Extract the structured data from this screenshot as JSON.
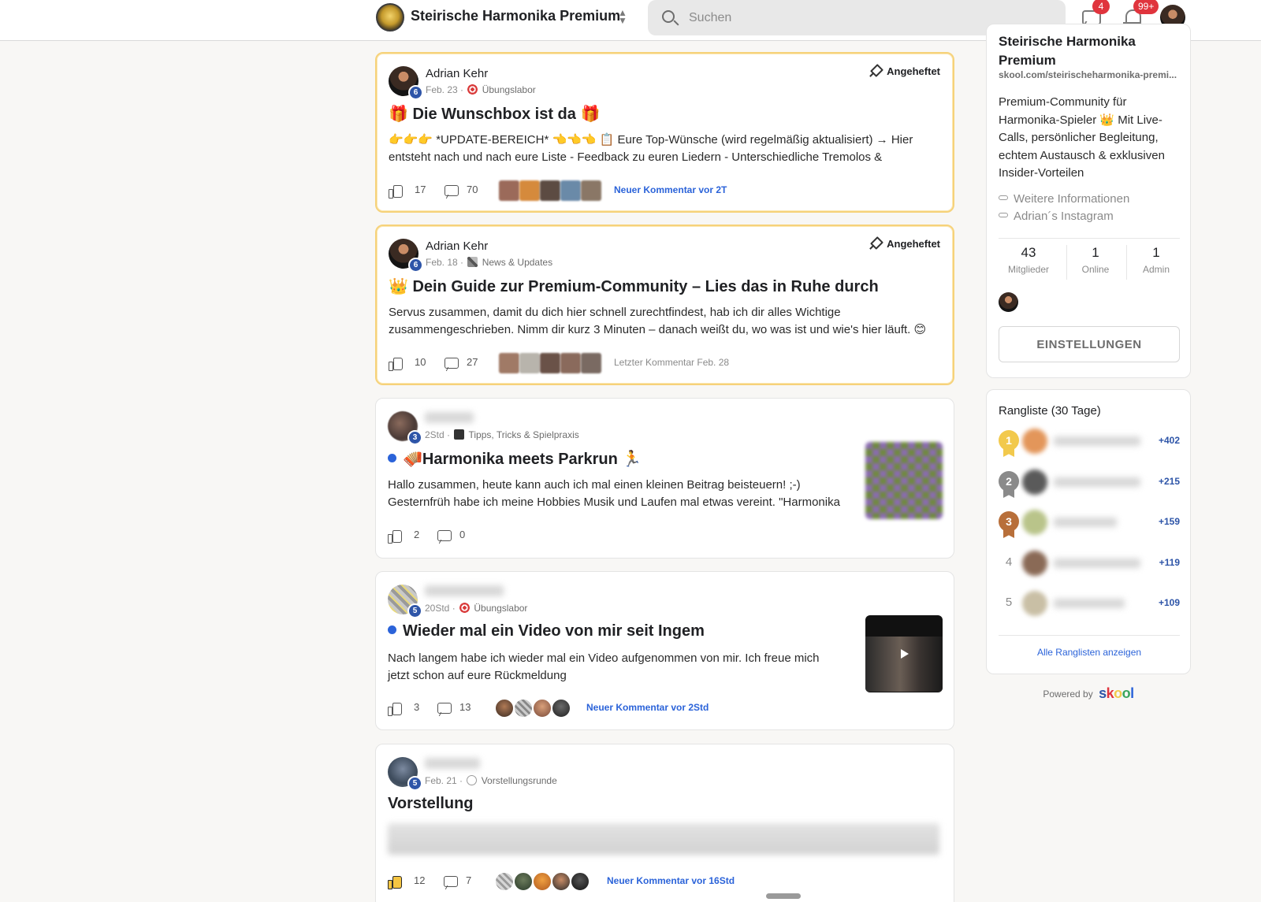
{
  "header": {
    "community_name": "Steirische Harmonika Premium",
    "search_placeholder": "Suchen",
    "messages_badge": "4",
    "notifications_badge": "99+"
  },
  "posts": [
    {
      "author": "Adrian Kehr",
      "level": "6",
      "date": "Feb. 23",
      "category": "Übungslabor",
      "category_icon": "target-icon",
      "pinned_label": "Angeheftet",
      "title": "🎁 Die Wunschbox ist da 🎁",
      "excerpt": "👉👉👉 *UPDATE-BEREICH* 👈👈👈 📋 Eure Top-Wünsche (wird regelmäßig aktualisiert) → Hier entsteht nach und nach eure Liste - Feedback zu euren Liedern - Unterschiedliche Tremolos &",
      "likes": "17",
      "comments": "70",
      "activity": "Neuer Kommentar vor 2T"
    },
    {
      "author": "Adrian Kehr",
      "level": "6",
      "date": "Feb. 18",
      "category": "News & Updates",
      "category_icon": "pencil-icon",
      "pinned_label": "Angeheftet",
      "title": "👑 Dein Guide zur Premium-Community – Lies das in Ruhe durch",
      "excerpt": "Servus zusammen, damit du dich hier schnell zurechtfindest, hab ich dir alles Wichtige zusammengeschrieben. Nimm dir kurz 3 Minuten – danach weißt du, wo was ist und wie's hier läuft. 😊",
      "likes": "10",
      "comments": "27",
      "activity": "Letzter Kommentar Feb. 28"
    },
    {
      "author": "",
      "level": "3",
      "date": "2Std",
      "category": "Tipps, Tricks & Spielpraxis",
      "category_icon": "graduation-cap-icon",
      "title": "🪗Harmonika meets Parkrun 🏃",
      "excerpt": "Hallo zusammen, heute kann auch ich mal einen kleinen Beitrag beisteuern! ;-) Gesternfrüh habe ich meine Hobbies Musik und Laufen mal etwas vereint. \"Harmonika",
      "likes": "2",
      "comments": "0",
      "activity": ""
    },
    {
      "author": "",
      "level": "5",
      "date": "20Std",
      "category": "Übungslabor",
      "category_icon": "target-icon",
      "title": "Wieder mal ein Video von mir seit Ingem",
      "excerpt": "Nach langem habe ich wieder mal ein Video aufgenommen von mir. Ich freue mich jetzt schon auf eure Rückmeldung",
      "likes": "3",
      "comments": "13",
      "activity": "Neuer Kommentar vor 2Std"
    },
    {
      "author": "",
      "level": "5",
      "date": "Feb. 21",
      "category": "Vorstellungsrunde",
      "category_icon": "speech-bubble-icon",
      "title": "Vorstellung",
      "excerpt": "",
      "likes": "12",
      "comments": "7",
      "activity": "Neuer Kommentar vor 16Std"
    }
  ],
  "about": {
    "name": "Steirische Harmonika Premium",
    "url": "skool.com/steirischeharmonika-premi...",
    "description": "Premium-Community für Harmonika-Spieler 👑 Mit Live-Calls, persönlicher Begleitung, echtem Austausch & exklusiven Insider-Vorteilen",
    "links": [
      "Weitere Informationen",
      "Adrian´s Instagram"
    ],
    "stats": [
      {
        "value": "43",
        "label": "Mitglieder"
      },
      {
        "value": "1",
        "label": "Online"
      },
      {
        "value": "1",
        "label": "Admin"
      }
    ],
    "settings_label": "EINSTELLUNGEN"
  },
  "leaderboard": {
    "title": "Rangliste (30 Tage)",
    "entries": [
      {
        "rank": "1",
        "points": "+402"
      },
      {
        "rank": "2",
        "points": "+215"
      },
      {
        "rank": "3",
        "points": "+159"
      },
      {
        "rank": "4",
        "points": "+119"
      },
      {
        "rank": "5",
        "points": "+109"
      }
    ],
    "all_link": "Alle Ranglisten anzeigen"
  },
  "footer": {
    "powered_by": "Powered by",
    "brand": "skool"
  },
  "colors": {
    "accent_blue": "#2b63d9",
    "pinned_border": "#f6d27a",
    "badge_red": "#e0343d",
    "level_blue": "#2e55a8"
  }
}
